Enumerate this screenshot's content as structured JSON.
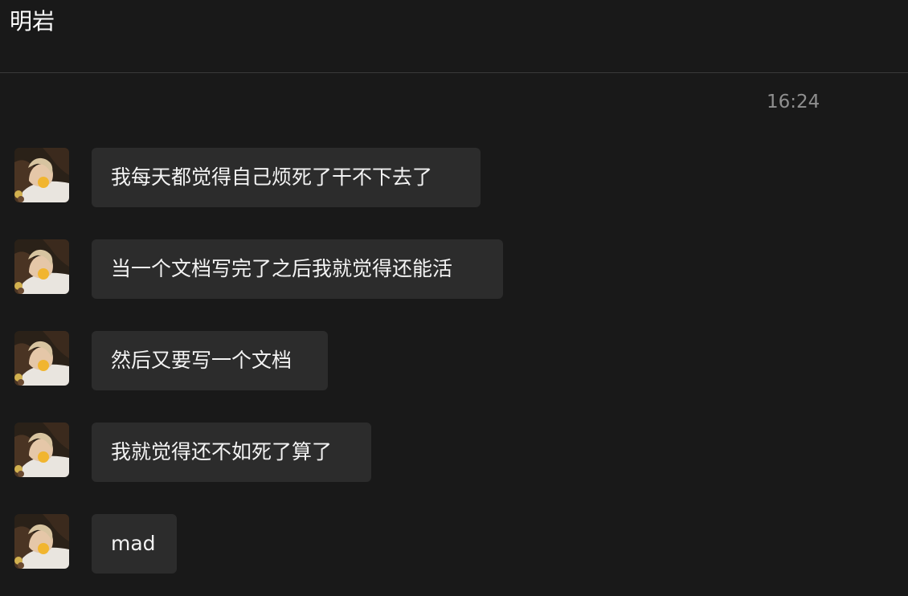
{
  "header": {
    "title": "明岩"
  },
  "conversation": {
    "timestamp": "16:24",
    "messages": [
      {
        "text": "我每天都觉得自己烦死了干不下去了",
        "avatar_icon": "contact-avatar"
      },
      {
        "text": "当一个文档写完了之后我就觉得还能活",
        "avatar_icon": "contact-avatar"
      },
      {
        "text": "然后又要写一个文档",
        "avatar_icon": "contact-avatar"
      },
      {
        "text": "我就觉得还不如死了算了",
        "avatar_icon": "contact-avatar"
      },
      {
        "text": "mad",
        "avatar_icon": "contact-avatar"
      }
    ]
  },
  "theme": {
    "background": "#191919",
    "bubble": "#2c2c2c",
    "text": "#f3f3f3",
    "timestamp": "#8f8f8f",
    "divider": "#3a3a3a"
  }
}
